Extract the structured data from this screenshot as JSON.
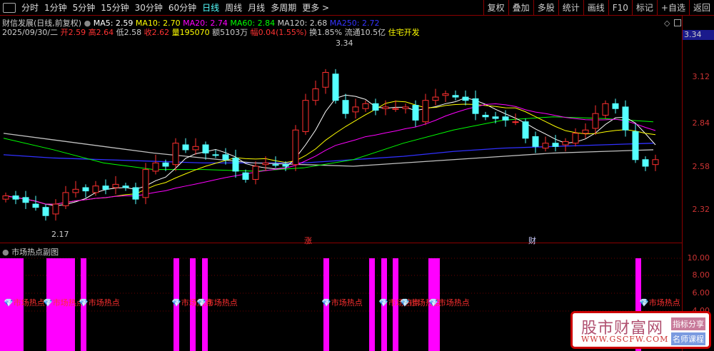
{
  "toolbar": {
    "periods": [
      "分时",
      "1分钟",
      "5分钟",
      "15分钟",
      "30分钟",
      "60分钟",
      "日线",
      "周线",
      "月线",
      "多周期",
      "更多 >"
    ],
    "active": "日线",
    "buttons": [
      "复权",
      "叠加",
      "多股",
      "统计",
      "画线",
      "F10",
      "标记",
      "+自选",
      "返回"
    ]
  },
  "stock": {
    "title": "财信发展(日线,前复权)",
    "ma5": "MA5: 2.59",
    "ma10": "MA10: 2.70",
    "ma20": "MA20: 2.74",
    "ma60": "MA60: 2.84",
    "ma120": "MA120: 2.68",
    "ma250": "MA250: 2.72",
    "date": "2025/09/30/二",
    "open": "开2.59",
    "high": "高2.64",
    "low": "低2.58",
    "close": "收2.62",
    "vol": "量195070",
    "amount": "额5103万",
    "change": "幅0.04(1.55%)",
    "turnover": "换1.85%",
    "float": "流通10.5亿",
    "sector": "住宅开发"
  },
  "axis": {
    "highlight": "3.34",
    "ticks": [
      "3.12",
      "2.84",
      "2.58",
      "2.32"
    ],
    "sub_ticks": [
      "10.00",
      "8.00",
      "6.00",
      "4.00"
    ]
  },
  "annotations": {
    "max": "3.34",
    "min": "2.17",
    "mark1": "涨",
    "mark2": "财"
  },
  "sub": {
    "title": "市场热点副图",
    "label": "市场热点"
  },
  "colors": {
    "up": "#ff3030",
    "down": "#54ffff",
    "ma5": "#ffffff",
    "ma10": "#ffff00",
    "ma20": "#ff00ff",
    "ma60": "#00ff00",
    "ma120": "#c0c0c0",
    "ma250": "#3030ff",
    "hot": "#ff00ff"
  },
  "chart_data": {
    "type": "candlestick",
    "closes": [
      2.4,
      2.38,
      2.36,
      2.33,
      2.28,
      2.35,
      2.42,
      2.44,
      2.43,
      2.46,
      2.44,
      2.47,
      2.45,
      2.38,
      2.56,
      2.6,
      2.58,
      2.72,
      2.68,
      2.7,
      2.66,
      2.65,
      2.62,
      2.55,
      2.5,
      2.58,
      2.6,
      2.59,
      2.58,
      2.8,
      2.98,
      3.05,
      3.15,
      2.98,
      2.9,
      2.94,
      2.96,
      2.92,
      2.94,
      2.93,
      2.94,
      2.86,
      2.98,
      3.0,
      3.02,
      3.0,
      2.98,
      2.9,
      2.88,
      2.87,
      2.86,
      2.85,
      2.75,
      2.7,
      2.72,
      2.7,
      2.73,
      2.78,
      2.8,
      2.9,
      2.96,
      2.93,
      2.8,
      2.62,
      2.58,
      2.62
    ],
    "hot_signal_candles": [
      0,
      1,
      2,
      5,
      6,
      7,
      8,
      17,
      19,
      20,
      32,
      37,
      38,
      39,
      43,
      44,
      63
    ]
  },
  "watermark": {
    "name": "股市财富网",
    "url": "WWW.GSCFW.COM",
    "btn1": "指标分享",
    "btn2": "名师课程"
  }
}
